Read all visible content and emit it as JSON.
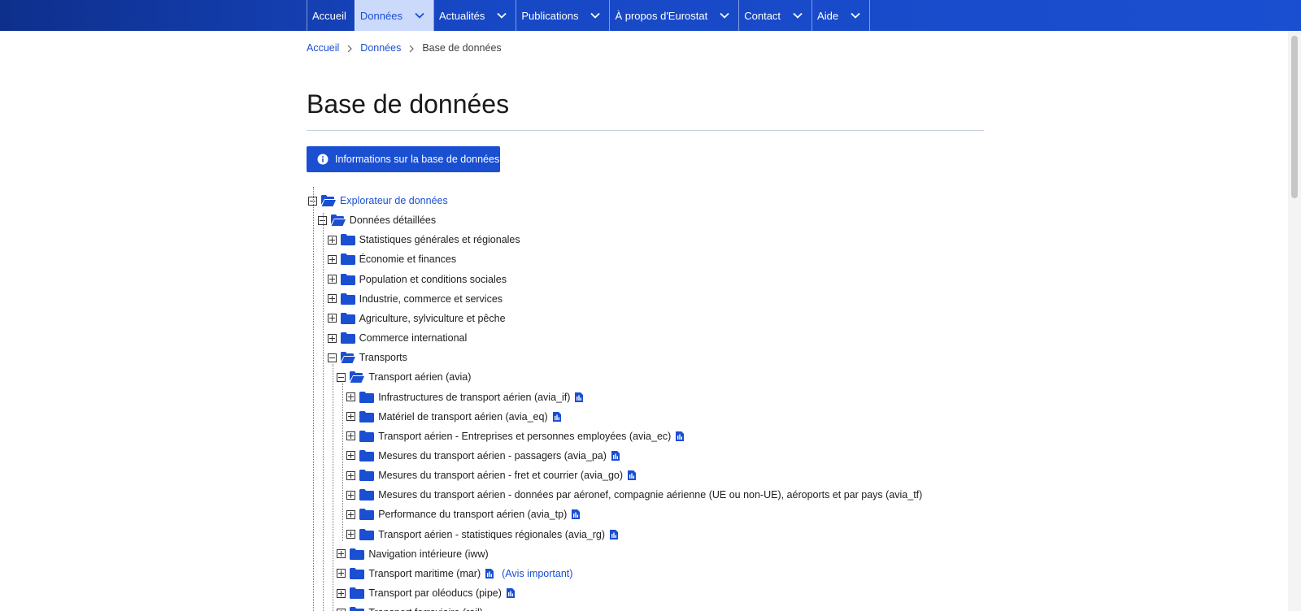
{
  "colors": {
    "brand": "#1a4fd1",
    "nav_dark": "#0e2f8c",
    "active_bg": "#cbd9fb"
  },
  "nav": {
    "items": [
      {
        "label": "Accueil",
        "has_dropdown": false,
        "active": false
      },
      {
        "label": "Données",
        "has_dropdown": true,
        "active": true
      },
      {
        "label": "Actualités",
        "has_dropdown": true,
        "active": false
      },
      {
        "label": "Publications",
        "has_dropdown": true,
        "active": false
      },
      {
        "label": "À propos d'Eurostat",
        "has_dropdown": true,
        "active": false
      },
      {
        "label": "Contact",
        "has_dropdown": true,
        "active": false
      },
      {
        "label": "Aide",
        "has_dropdown": true,
        "active": false
      }
    ]
  },
  "breadcrumb": {
    "home": "Accueil",
    "section": "Données",
    "current": "Base de données"
  },
  "page": {
    "title": "Base de données"
  },
  "info_button": {
    "label": "Informations sur la base de données",
    "icon": "info-icon"
  },
  "tree": {
    "root": {
      "label": "Explorateur de données",
      "expanded": true
    },
    "detailed": {
      "label": "Données détaillées",
      "expanded": true
    },
    "themes": [
      {
        "label": "Statistiques générales et régionales",
        "expanded": false
      },
      {
        "label": "Économie et finances",
        "expanded": false
      },
      {
        "label": "Population et conditions sociales",
        "expanded": false
      },
      {
        "label": "Industrie, commerce et services",
        "expanded": false
      },
      {
        "label": "Agriculture, sylviculture et pêche",
        "expanded": false
      },
      {
        "label": "Commerce international",
        "expanded": false
      },
      {
        "label": "Transports",
        "expanded": true
      }
    ],
    "transport_items": [
      {
        "label": "Transport aérien (avia)",
        "expanded": true,
        "metadata": false
      },
      {
        "label": "Navigation intérieure (iww)",
        "expanded": false,
        "metadata": false
      },
      {
        "label": "Transport maritime (mar)",
        "expanded": false,
        "metadata": true,
        "notice": "(Avis important)"
      },
      {
        "label": "Transport par oléoducs (pipe)",
        "expanded": false,
        "metadata": true
      },
      {
        "label": "Transport ferroviaire (rail)",
        "expanded": false,
        "metadata": false
      }
    ],
    "avia_items": [
      {
        "label": "Infrastructures de transport aérien (avia_if)",
        "metadata": true
      },
      {
        "label": "Matériel de transport aérien (avia_eq)",
        "metadata": true
      },
      {
        "label": "Transport aérien - Entreprises et personnes employées (avia_ec)",
        "metadata": true
      },
      {
        "label": "Mesures du transport aérien - passagers (avia_pa)",
        "metadata": true
      },
      {
        "label": "Mesures du transport aérien - fret et courrier (avia_go)",
        "metadata": true
      },
      {
        "label": "Mesures du transport aérien - données par aéronef, compagnie aérienne (UE ou non-UE), aéroports et par pays (avia_tf)",
        "metadata": false
      },
      {
        "label": "Performance du transport aérien (avia_tp)",
        "metadata": true
      },
      {
        "label": "Transport aérien - statistiques régionales (avia_rg)",
        "metadata": true
      }
    ]
  }
}
